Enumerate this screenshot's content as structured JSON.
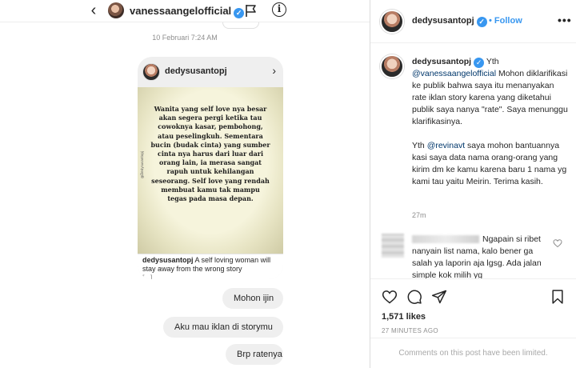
{
  "dm": {
    "username": "vanessaangelofficial",
    "timestamp": "10 Februari 7:24 AM",
    "shared_post": {
      "username": "dedysusantopj",
      "quote_text": "Wanita yang self love nya besar akan segera pergi ketika tau cowoknya kasar, pembohong, atau peselingkuh. Sementara bucin (budak cinta) yang sumber cinta nya harus dari luar dari orang lain, ia merasa sangat rapuh untuk kehilangan seseorang. Self love yang rendah membuat kamu tak mampu tegas pada masa depan.",
      "watermark": "@Dedysusantopj",
      "caption_user": "dedysusantopj",
      "caption_text": "A self loving woman will stay away from the wrong story",
      "caption_more": "[...]"
    },
    "messages": [
      "Mohon ijin",
      "Aku mau iklan di storymu",
      "Brp ratenya"
    ]
  },
  "post": {
    "author": "dedysusantopj",
    "follow_label": "Follow",
    "more_label": "•••",
    "caption": {
      "user": "dedysusantopj",
      "p1_prefix": "Yth",
      "p1_mention": "@vanessaangelofficial",
      "p1_text": "Mohon diklarifikasi ke publik bahwa saya itu menanyakan rate iklan story karena yang diketahui publik saya nanya \"rate\". Saya menunggu klarifikasinya.",
      "p2_prefix": "Yth",
      "p2_mention": "@revinavt",
      "p2_text": "saya mohon bantuannya kasi saya data nama orang-orang yang kirim dm ke kamu karena baru 1 nama yg kami tau yaitu Meirin. Terima kasih.",
      "time": "27m"
    },
    "comment": {
      "text": "Ngapain si ribet nanyain list nama, kalo bener ga salah ya laporin aja lgsg. Ada jalan simple kok milih yg"
    },
    "likes": "1,571 likes",
    "time_ago": "27 MINUTES AGO",
    "comments_disabled": "Comments on this post have been limited."
  },
  "colors": {
    "link": "#3897f0",
    "mention": "#00376b",
    "bubble": "#efefef"
  }
}
